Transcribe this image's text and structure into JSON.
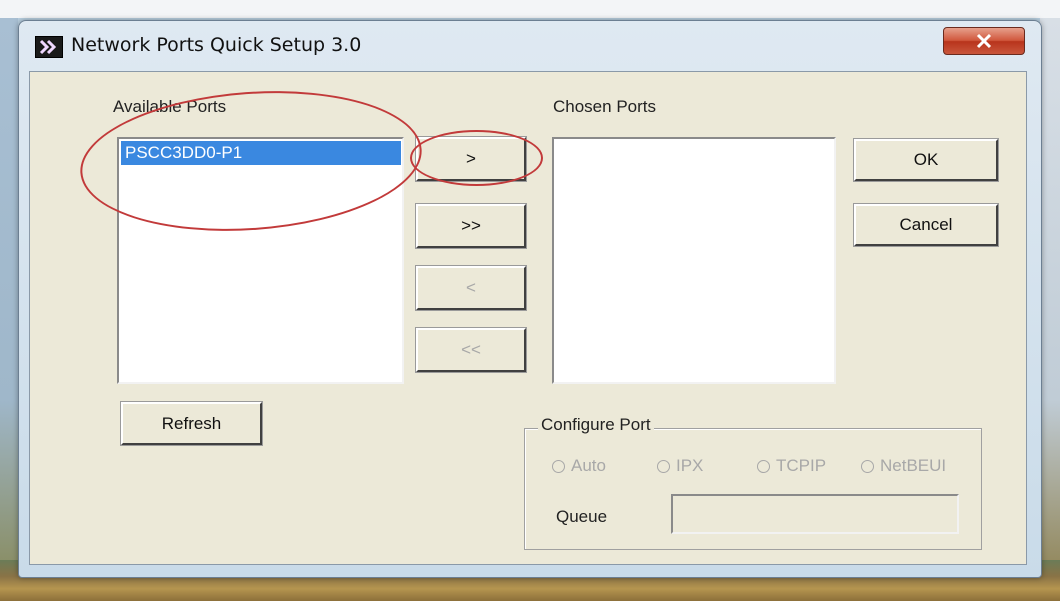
{
  "window": {
    "title": "Network Ports Quick Setup 3.0",
    "title_icon": "double-chevron-icon",
    "close_icon": "close-icon"
  },
  "available_ports": {
    "label": "Available Ports",
    "items": [
      "PSCC3DD0-P1"
    ],
    "selected_index": 0
  },
  "chosen_ports": {
    "label": "Chosen Ports",
    "items": []
  },
  "transfer_buttons": {
    "add": ">",
    "add_all": ">>",
    "remove": "<",
    "remove_all": "<<"
  },
  "dialog_buttons": {
    "ok": "OK",
    "cancel": "Cancel",
    "refresh": "Refresh"
  },
  "configure_port": {
    "title": "Configure Port",
    "options": [
      "Auto",
      "IPX",
      "TCPIP",
      "NetBEUI"
    ],
    "queue_label": "Queue",
    "queue_value": ""
  },
  "colors": {
    "selection": "#3a88e0",
    "annotation": "#c23a3a",
    "dialog_face": "#ece9d8"
  }
}
